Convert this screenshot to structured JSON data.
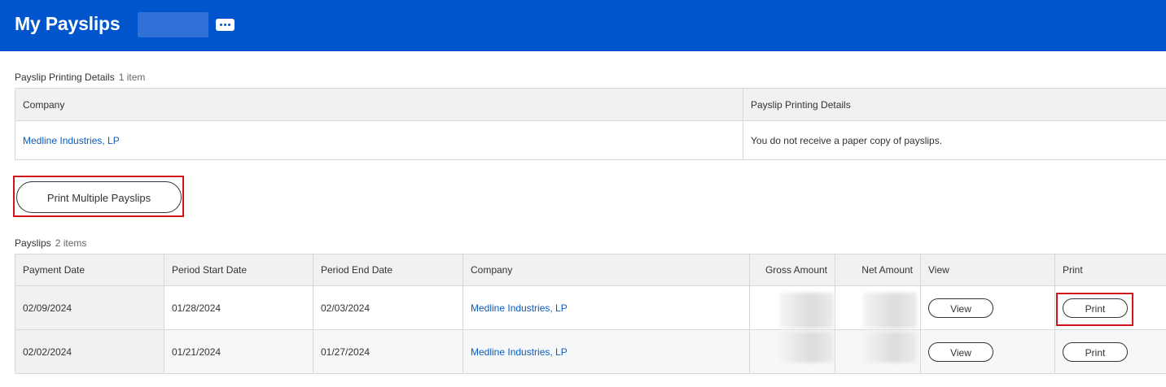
{
  "header": {
    "title": "My Payslips",
    "more_icon": "ellipsis-icon"
  },
  "printing_details": {
    "title": "Payslip Printing Details",
    "count": "1 item",
    "columns": [
      "Company",
      "Payslip Printing Details"
    ],
    "rows": [
      {
        "company": "Medline Industries, LP",
        "details": "You do not receive a paper copy of payslips."
      }
    ]
  },
  "print_multiple_label": "Print Multiple Payslips",
  "payslips": {
    "title": "Payslips",
    "count": "2 items",
    "columns": [
      "Payment Date",
      "Period Start Date",
      "Period End Date",
      "Company",
      "Gross Amount",
      "Net Amount",
      "View",
      "Print"
    ],
    "rows": [
      {
        "payment_date": "02/09/2024",
        "period_start": "01/28/2024",
        "period_end": "02/03/2024",
        "company": "Medline Industries, LP",
        "view_label": "View",
        "print_label": "Print"
      },
      {
        "payment_date": "02/02/2024",
        "period_start": "01/21/2024",
        "period_end": "01/27/2024",
        "company": "Medline Industries, LP",
        "view_label": "View",
        "print_label": "Print"
      }
    ]
  },
  "colors": {
    "header_bg": "#0055cc",
    "link": "#0b5cbf",
    "highlight": "#d0121b"
  }
}
